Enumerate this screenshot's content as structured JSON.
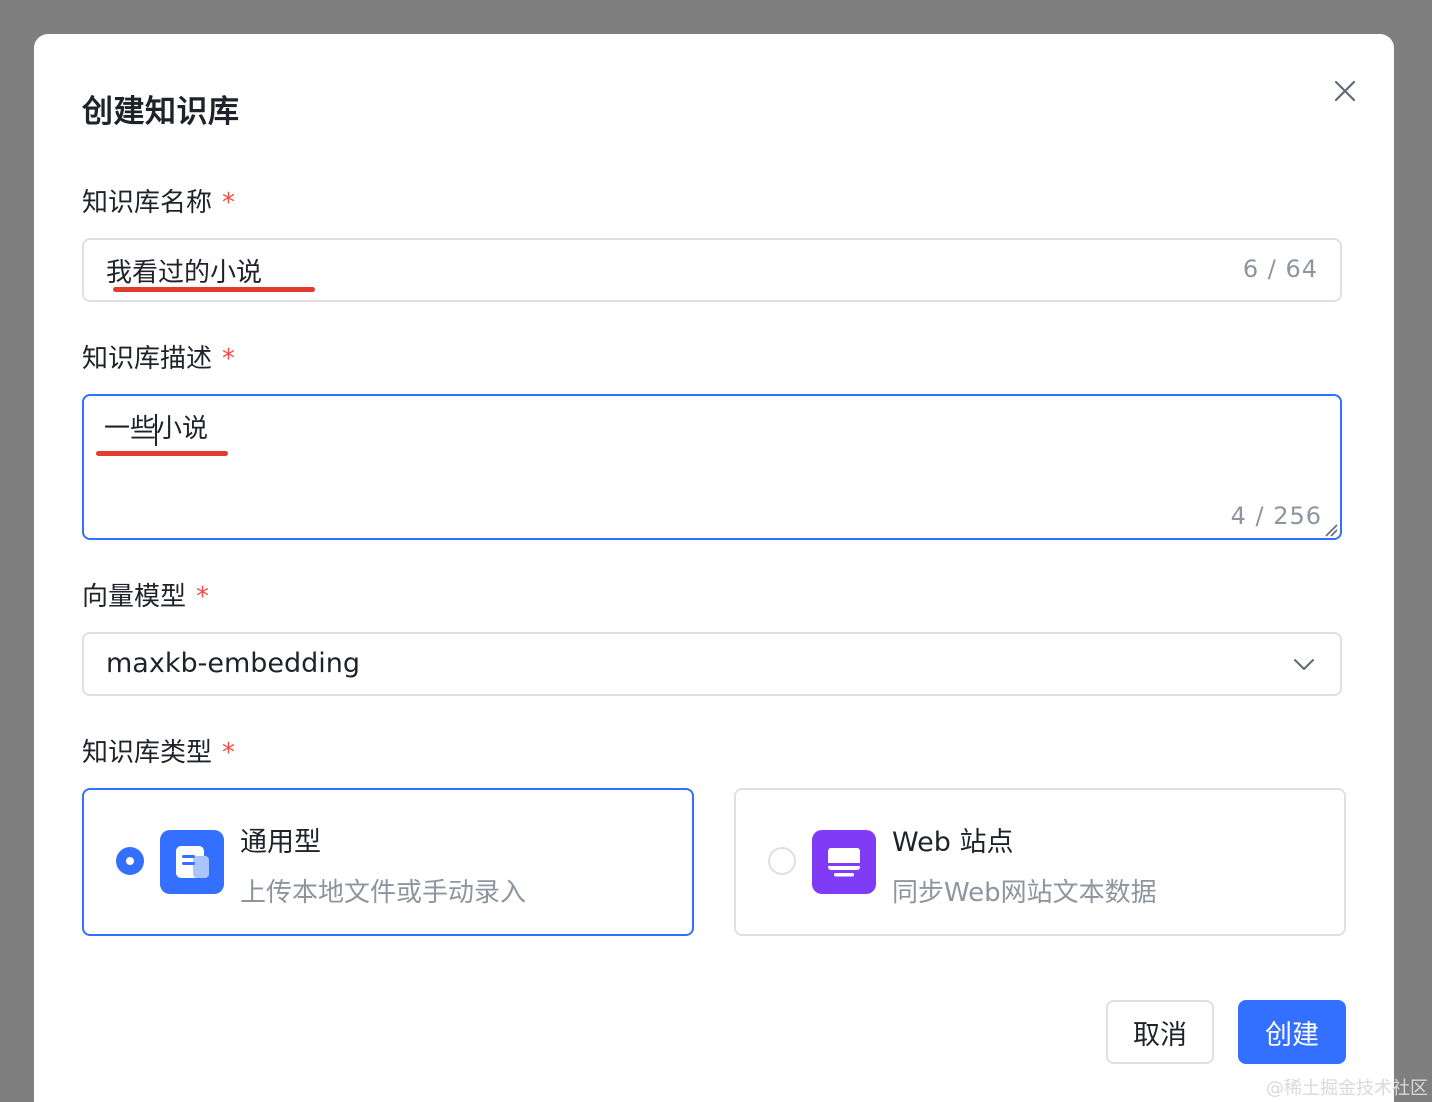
{
  "dialog": {
    "title": "创建知识库",
    "close_icon": "close-icon"
  },
  "name_field": {
    "label": "知识库名称",
    "required_mark": "*",
    "value": "我看过的小说",
    "counter": "6 / 64"
  },
  "desc_field": {
    "label": "知识库描述",
    "required_mark": "*",
    "value_before_caret": "一些",
    "value_after_caret": "小说",
    "counter": "4 / 256"
  },
  "model_field": {
    "label": "向量模型",
    "required_mark": "*",
    "selected": "maxkb-embedding",
    "dropdown_icon": "chevron-down-icon"
  },
  "type_field": {
    "label": "知识库类型",
    "required_mark": "*",
    "options": [
      {
        "title": "通用型",
        "description": "上传本地文件或手动录入",
        "selected": true,
        "icon": "document-icon",
        "icon_color": "#3370ff"
      },
      {
        "title": "Web 站点",
        "description": "同步Web网站文本数据",
        "selected": false,
        "icon": "monitor-icon",
        "icon_color": "#7f3bf5"
      }
    ]
  },
  "footer": {
    "cancel_label": "取消",
    "create_label": "创建"
  },
  "watermark": "@稀土掘金技术社区",
  "colors": {
    "primary": "#3370ff",
    "required": "#f54a45",
    "annotation_underline": "#e23c2e"
  }
}
